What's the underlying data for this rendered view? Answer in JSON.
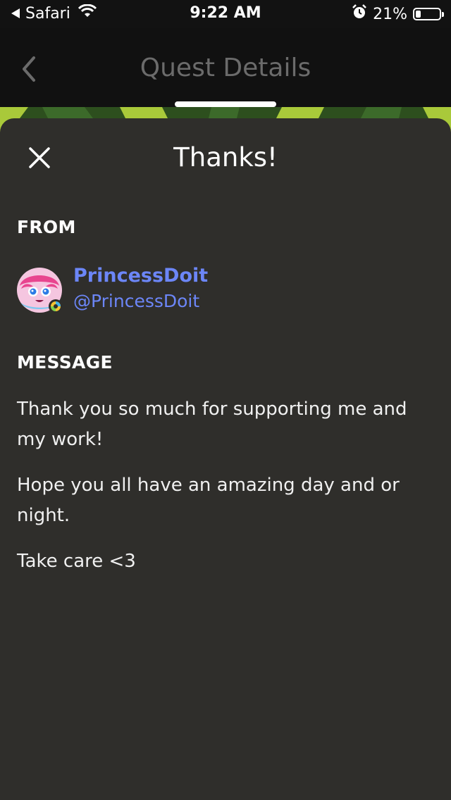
{
  "status_bar": {
    "back_app": "Safari",
    "time": "9:22 AM",
    "battery_text": "21%",
    "battery_level": 0.21
  },
  "nav": {
    "title": "Quest Details"
  },
  "sheet": {
    "title": "Thanks!",
    "from_label": "FROM",
    "sender": {
      "name": "PrincessDoit",
      "handle": "@PrincessDoit"
    },
    "message_label": "MESSAGE",
    "message_paragraphs": [
      "Thank you so much for supporting me and my work!",
      "Hope you all have an amazing day and or night.",
      "Take care <3"
    ]
  },
  "colors": {
    "accent": "#6c86f7",
    "sheet_bg": "#2f2e2b",
    "nav_bg": "#111111"
  }
}
